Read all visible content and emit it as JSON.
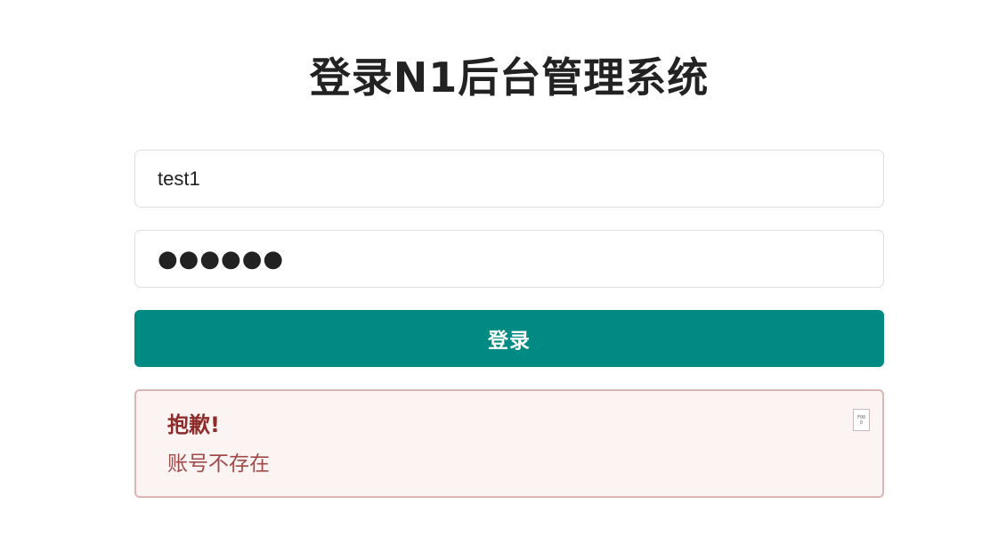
{
  "page": {
    "title": "登录N1后台管理系统"
  },
  "form": {
    "username_value": "test1",
    "password_value": "●●●●●●",
    "login_label": "登录"
  },
  "alert": {
    "title": "抱歉!",
    "message": "账号不存在",
    "close_glyph": "F000"
  },
  "colors": {
    "accent": "#008a84",
    "alert_bg": "#fcf4f3",
    "alert_border": "#dcb5b5",
    "alert_title": "#8e2c2c",
    "alert_text": "#a04a4a"
  },
  "icons": {
    "close": "close-icon"
  }
}
